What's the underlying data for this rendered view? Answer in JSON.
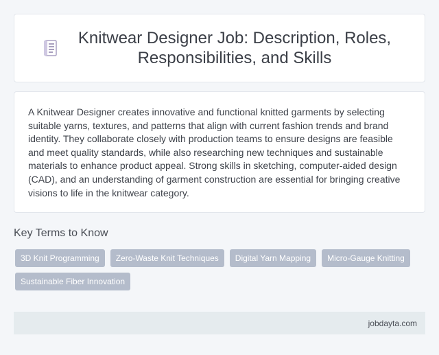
{
  "header": {
    "icon": "document-icon",
    "title": "Knitwear Designer Job: Description, Roles, Responsibilities, and Skills"
  },
  "description": {
    "text": "A Knitwear Designer creates innovative and functional knitted garments by selecting suitable yarns, textures, and patterns that align with current fashion trends and brand identity. They collaborate closely with production teams to ensure designs are feasible and meet quality standards, while also researching new techniques and sustainable materials to enhance product appeal. Strong skills in sketching, computer-aided design (CAD), and an understanding of garment construction are essential for bringing creative visions to life in the knitwear category."
  },
  "key_terms": {
    "heading": "Key Terms to Know",
    "tags": [
      "3D Knit Programming",
      "Zero-Waste Knit Techniques",
      "Digital Yarn Mapping",
      "Micro-Gauge Knitting",
      "Sustainable Fiber Innovation"
    ]
  },
  "footer": {
    "site": "jobdayta.com"
  },
  "colors": {
    "background": "#f4f6f9",
    "card": "#ffffff",
    "tag": "#b4bccb",
    "footer": "#e5ebee",
    "icon": "#8a7fa8"
  }
}
